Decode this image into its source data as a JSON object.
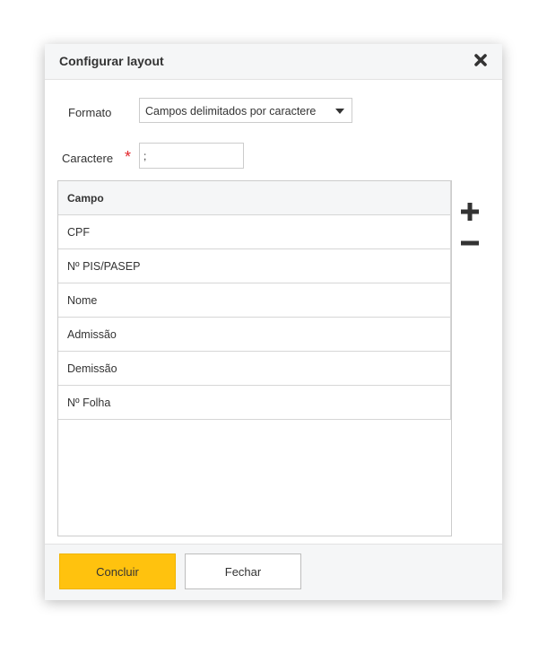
{
  "dialog": {
    "title": "Configurar layout"
  },
  "form": {
    "format_label": "Formato",
    "format_value": "Campos delimitados por caractere",
    "char_label": "Caractere",
    "required_mark": "*",
    "char_value": ";"
  },
  "table": {
    "header": "Campo",
    "rows": [
      "CPF",
      "Nº PIS/PASEP",
      "Nome",
      "Admissão",
      "Demissão",
      "Nº Folha"
    ]
  },
  "footer": {
    "confirm_label": "Concluir",
    "close_label": "Fechar"
  },
  "colors": {
    "primary": "#ffc20e",
    "required": "#e3262c"
  },
  "icons": {
    "close": "close-icon",
    "add": "plus-icon",
    "remove": "minus-icon",
    "dropdown": "chevron-down-icon"
  }
}
